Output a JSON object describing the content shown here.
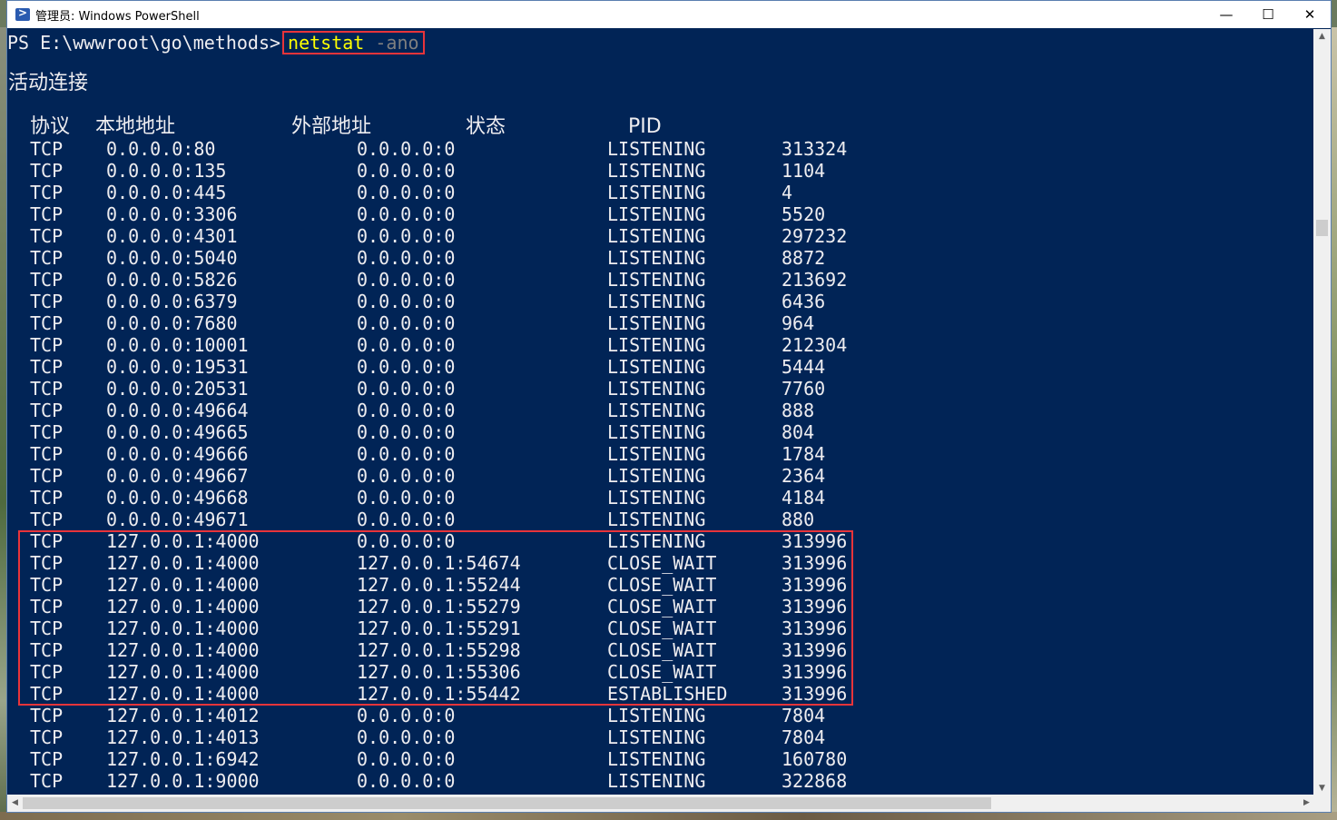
{
  "window": {
    "title": "管理员: Windows PowerShell",
    "minimize": "—",
    "maximize": "☐",
    "close": "✕"
  },
  "console": {
    "prompt": "PS E:\\wwwroot\\go\\methods>",
    "command": "netstat",
    "argument": "-ano",
    "heading": "活动连接",
    "columns": [
      "协议",
      "本地地址",
      "外部地址",
      "状态",
      "PID"
    ],
    "rows": [
      [
        "TCP",
        "0.0.0.0:80",
        "0.0.0.0:0",
        "LISTENING",
        "313324"
      ],
      [
        "TCP",
        "0.0.0.0:135",
        "0.0.0.0:0",
        "LISTENING",
        "1104"
      ],
      [
        "TCP",
        "0.0.0.0:445",
        "0.0.0.0:0",
        "LISTENING",
        "4"
      ],
      [
        "TCP",
        "0.0.0.0:3306",
        "0.0.0.0:0",
        "LISTENING",
        "5520"
      ],
      [
        "TCP",
        "0.0.0.0:4301",
        "0.0.0.0:0",
        "LISTENING",
        "297232"
      ],
      [
        "TCP",
        "0.0.0.0:5040",
        "0.0.0.0:0",
        "LISTENING",
        "8872"
      ],
      [
        "TCP",
        "0.0.0.0:5826",
        "0.0.0.0:0",
        "LISTENING",
        "213692"
      ],
      [
        "TCP",
        "0.0.0.0:6379",
        "0.0.0.0:0",
        "LISTENING",
        "6436"
      ],
      [
        "TCP",
        "0.0.0.0:7680",
        "0.0.0.0:0",
        "LISTENING",
        "964"
      ],
      [
        "TCP",
        "0.0.0.0:10001",
        "0.0.0.0:0",
        "LISTENING",
        "212304"
      ],
      [
        "TCP",
        "0.0.0.0:19531",
        "0.0.0.0:0",
        "LISTENING",
        "5444"
      ],
      [
        "TCP",
        "0.0.0.0:20531",
        "0.0.0.0:0",
        "LISTENING",
        "7760"
      ],
      [
        "TCP",
        "0.0.0.0:49664",
        "0.0.0.0:0",
        "LISTENING",
        "888"
      ],
      [
        "TCP",
        "0.0.0.0:49665",
        "0.0.0.0:0",
        "LISTENING",
        "804"
      ],
      [
        "TCP",
        "0.0.0.0:49666",
        "0.0.0.0:0",
        "LISTENING",
        "1784"
      ],
      [
        "TCP",
        "0.0.0.0:49667",
        "0.0.0.0:0",
        "LISTENING",
        "2364"
      ],
      [
        "TCP",
        "0.0.0.0:49668",
        "0.0.0.0:0",
        "LISTENING",
        "4184"
      ],
      [
        "TCP",
        "0.0.0.0:49671",
        "0.0.0.0:0",
        "LISTENING",
        "880"
      ],
      [
        "TCP",
        "127.0.0.1:4000",
        "0.0.0.0:0",
        "LISTENING",
        "313996"
      ],
      [
        "TCP",
        "127.0.0.1:4000",
        "127.0.0.1:54674",
        "CLOSE_WAIT",
        "313996"
      ],
      [
        "TCP",
        "127.0.0.1:4000",
        "127.0.0.1:55244",
        "CLOSE_WAIT",
        "313996"
      ],
      [
        "TCP",
        "127.0.0.1:4000",
        "127.0.0.1:55279",
        "CLOSE_WAIT",
        "313996"
      ],
      [
        "TCP",
        "127.0.0.1:4000",
        "127.0.0.1:55291",
        "CLOSE_WAIT",
        "313996"
      ],
      [
        "TCP",
        "127.0.0.1:4000",
        "127.0.0.1:55298",
        "CLOSE_WAIT",
        "313996"
      ],
      [
        "TCP",
        "127.0.0.1:4000",
        "127.0.0.1:55306",
        "CLOSE_WAIT",
        "313996"
      ],
      [
        "TCP",
        "127.0.0.1:4000",
        "127.0.0.1:55442",
        "ESTABLISHED",
        "313996"
      ],
      [
        "TCP",
        "127.0.0.1:4012",
        "0.0.0.0:0",
        "LISTENING",
        "7804"
      ],
      [
        "TCP",
        "127.0.0.1:4013",
        "0.0.0.0:0",
        "LISTENING",
        "7804"
      ],
      [
        "TCP",
        "127.0.0.1:6942",
        "0.0.0.0:0",
        "LISTENING",
        "160780"
      ],
      [
        "TCP",
        "127.0.0.1:9000",
        "0.0.0.0:0",
        "LISTENING",
        "322868"
      ]
    ]
  },
  "colors": {
    "console_bg": "#012456",
    "console_fg": "#eeedf0",
    "command": "#ffff00",
    "argument": "#7f7f7f",
    "highlight": "#e8343a"
  },
  "icons": {
    "app": "powershell-icon",
    "scroll_up": "chevron-up-icon",
    "scroll_down": "chevron-down-icon",
    "scroll_left": "chevron-left-icon",
    "scroll_right": "chevron-right-icon"
  }
}
